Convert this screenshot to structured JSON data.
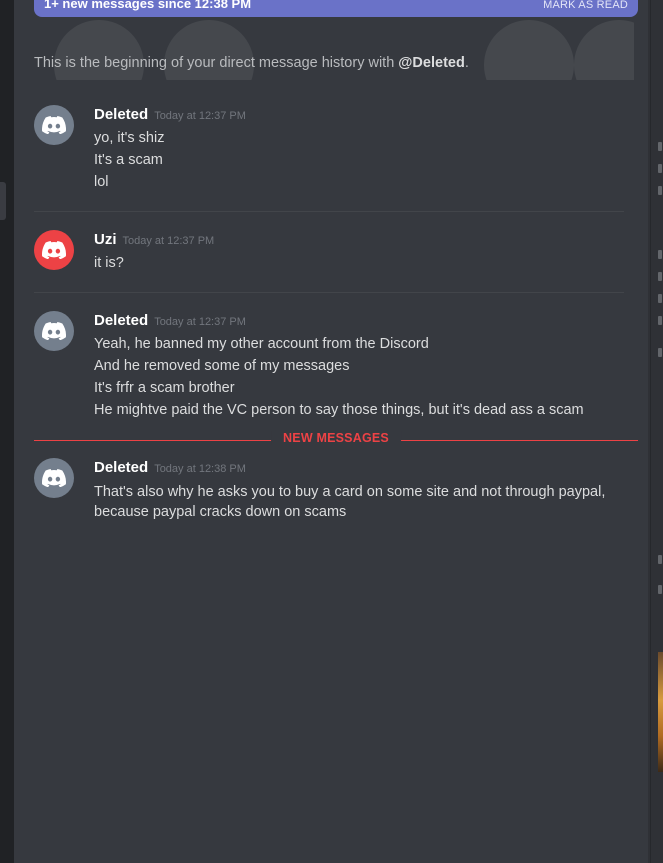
{
  "banner": {
    "text": "1+ new messages since 12:38 PM",
    "action": "MARK AS READ"
  },
  "history_intro": {
    "prefix": "This is the beginning of your direct message history with ",
    "user": "@Deleted",
    "suffix": "."
  },
  "messages": [
    {
      "author": "Deleted",
      "time": "Today at 12:37 PM",
      "avatar": "discord-icon",
      "avatar_color": "#747f8d",
      "lines": [
        "yo, it's shiz",
        "It's a scam",
        "lol"
      ]
    },
    {
      "author": "Uzi",
      "time": "Today at 12:37 PM",
      "avatar": "discord-icon",
      "avatar_color": "#ed4245",
      "lines": [
        "it is?"
      ]
    },
    {
      "author": "Deleted",
      "time": "Today at 12:37 PM",
      "avatar": "discord-icon",
      "avatar_color": "#747f8d",
      "lines": [
        "Yeah, he banned my other account from the Discord",
        "And he removed some of my messages",
        "It's frfr a scam brother",
        "He mightve paid the VC person to say those things, but it's dead ass a scam"
      ]
    },
    {
      "author": "Deleted",
      "time": "Today at 12:38 PM",
      "avatar": "discord-icon",
      "avatar_color": "#747f8d",
      "lines": [
        "That's also why he asks you to buy a card on some site and not through paypal, because paypal cracks down on scams"
      ]
    }
  ],
  "new_messages_label": "NEW MESSAGES",
  "colors": {
    "background": "#36393f",
    "banner": "#6a72c8",
    "new_messages": "#ed4245"
  }
}
